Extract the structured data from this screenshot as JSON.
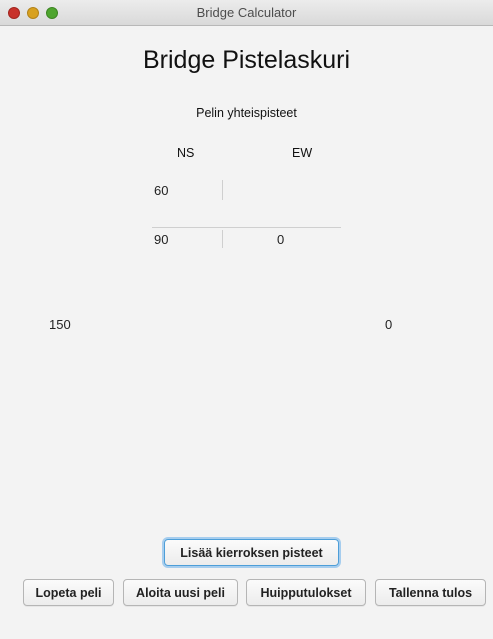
{
  "window": {
    "title": "Bridge Calculator"
  },
  "app": {
    "title": "Bridge Pistelaskuri",
    "subtitle": "Pelin yhteispisteet"
  },
  "scoreboard": {
    "ns_label": "NS",
    "ew_label": "EW",
    "above_line": {
      "ns": "60",
      "ew": ""
    },
    "below_line": {
      "ns": "90",
      "ew": "0"
    }
  },
  "totals": {
    "ns": "150",
    "ew": "0"
  },
  "buttons": {
    "add_round": "Lisää kierroksen pisteet",
    "end_game": "Lopeta peli",
    "new_game": "Aloita uusi peli",
    "high_scores": "Huipputulokset",
    "save_result": "Tallenna tulos"
  }
}
